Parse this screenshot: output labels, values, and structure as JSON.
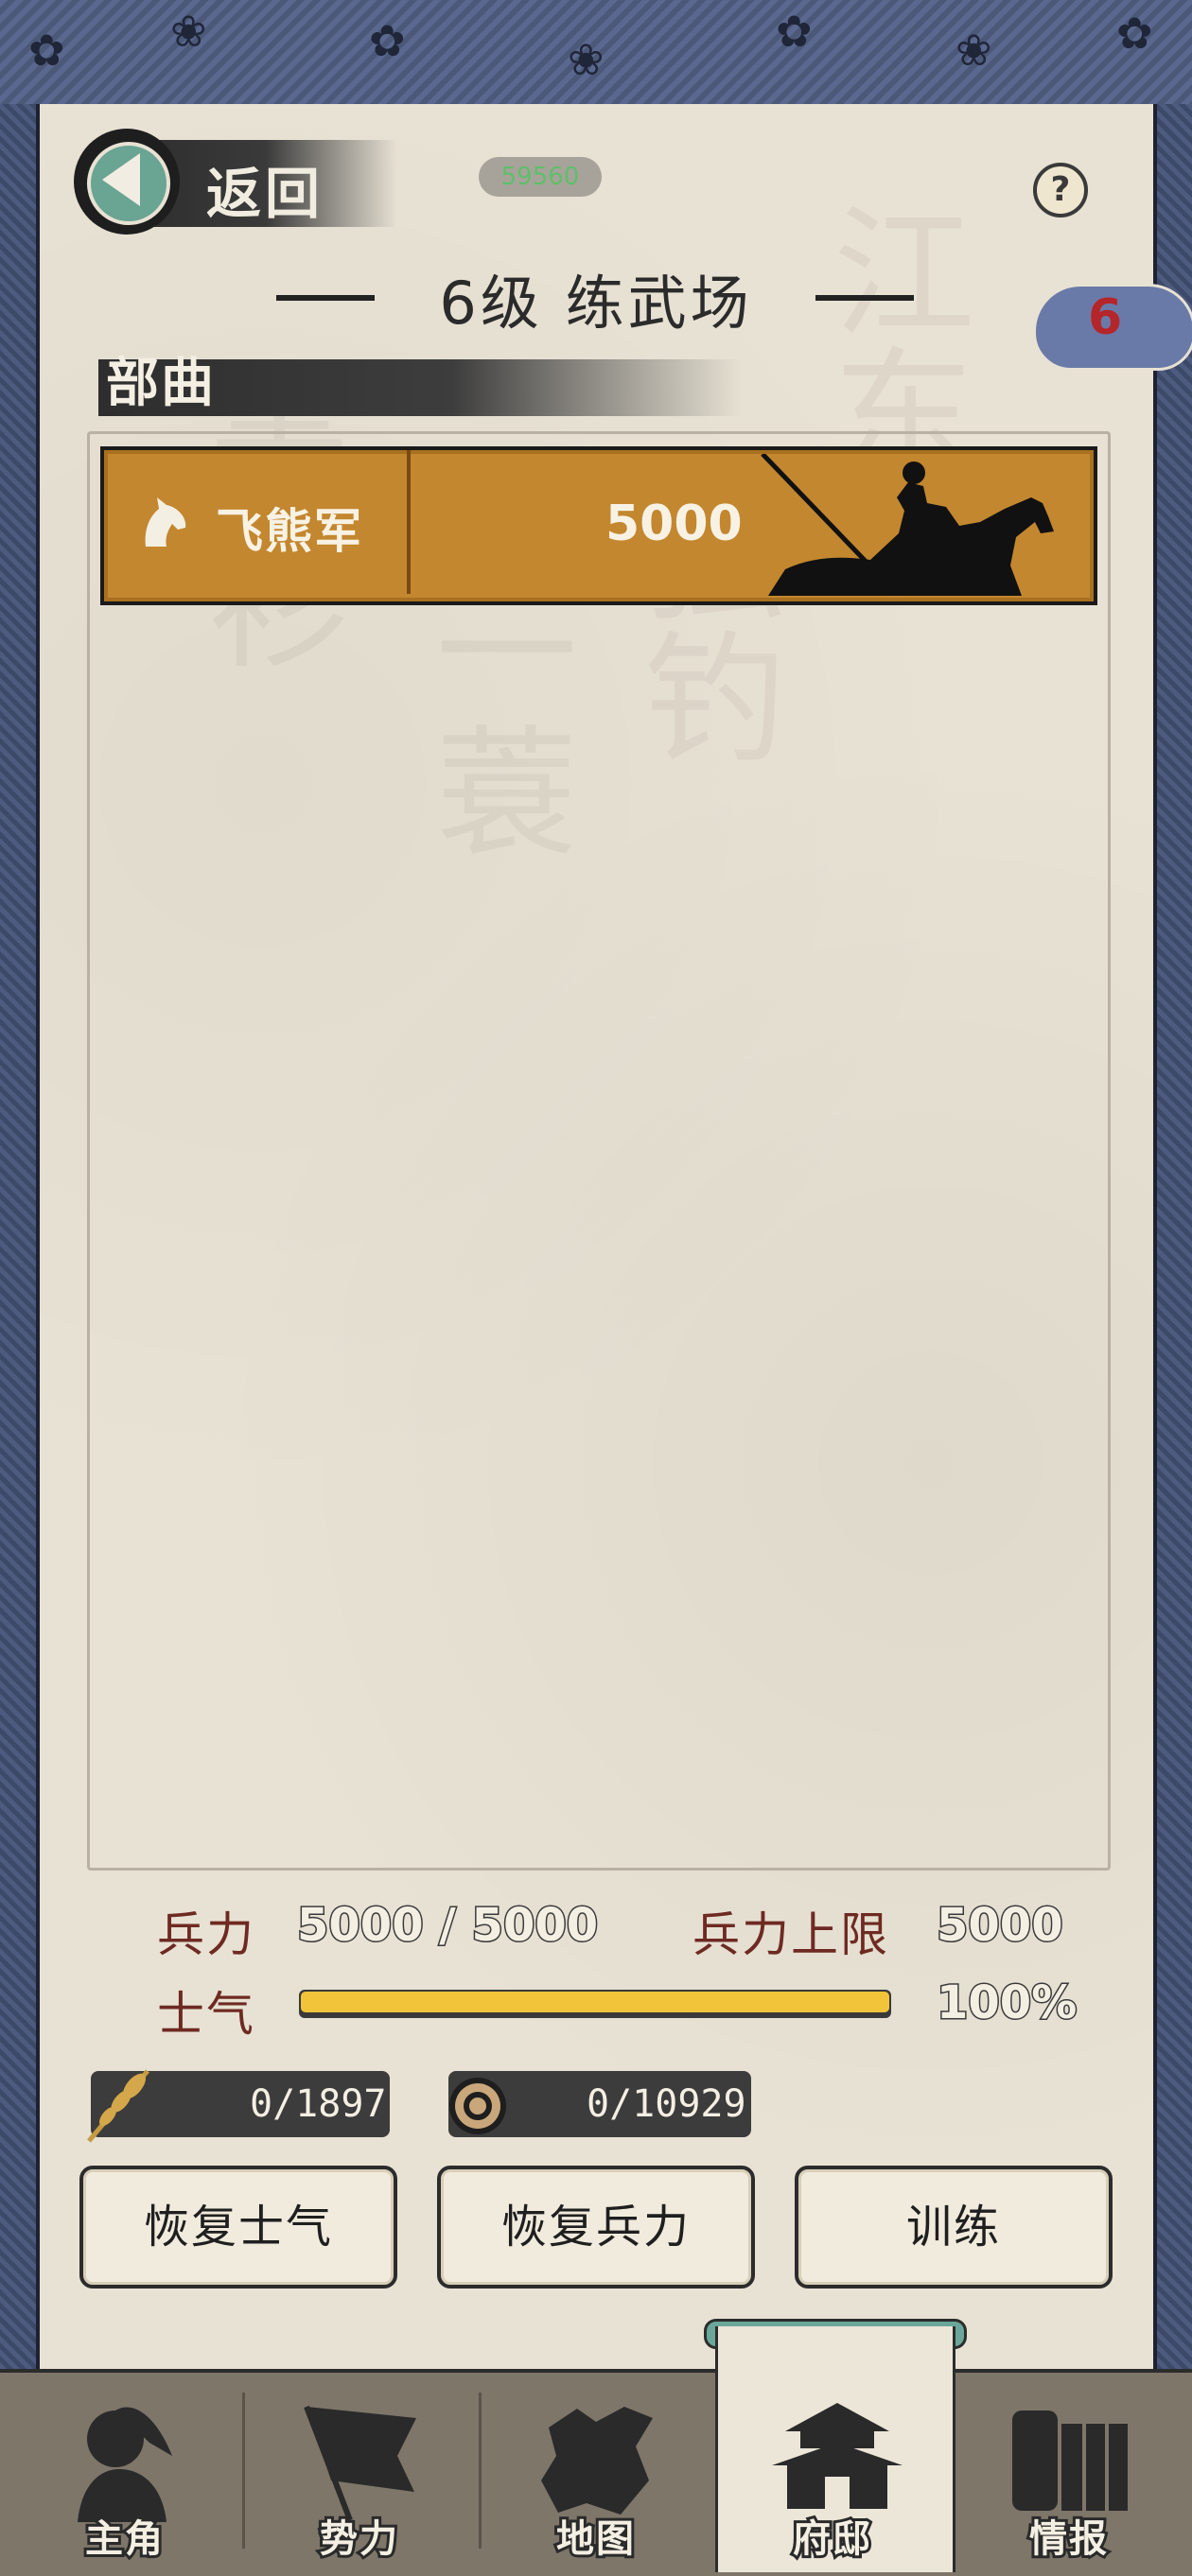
{
  "header": {
    "back_label": "返回",
    "badge_text": "59560",
    "help_symbol": "?",
    "title": "6级 练武场",
    "cloud_count": "6"
  },
  "section": {
    "label": "部曲"
  },
  "units": [
    {
      "name": "飞熊军",
      "count": "5000",
      "icon": "horse-head-icon"
    }
  ],
  "stats": {
    "troops_label": "兵力",
    "troops_value": "5000 / 5000",
    "troops_cap_label": "兵力上限",
    "troops_cap_value": "5000",
    "morale_label": "士气",
    "morale_value": "100%",
    "morale_fraction": 1.0
  },
  "resources": [
    {
      "icon": "wheat-icon",
      "value": "0/1897"
    },
    {
      "icon": "coin-icon",
      "value": "0/10929"
    }
  ],
  "actions": {
    "restore_morale": "恢复士气",
    "restore_troops": "恢复兵力",
    "train": "训练"
  },
  "nav": {
    "items": [
      {
        "label": "主角",
        "icon": "general-icon"
      },
      {
        "label": "势力",
        "icon": "flag-icon"
      },
      {
        "label": "地图",
        "icon": "map-icon"
      },
      {
        "label": "府邸",
        "icon": "mansion-icon",
        "active": true
      },
      {
        "label": "情报",
        "icon": "scrolls-icon"
      }
    ]
  },
  "colors": {
    "accent_teal": "#6aa493",
    "unit_row": "#c3872f",
    "morale_fill": "#f1c43a",
    "stat_label": "#6e2a22",
    "frame_blue": "#4d5b7e"
  }
}
